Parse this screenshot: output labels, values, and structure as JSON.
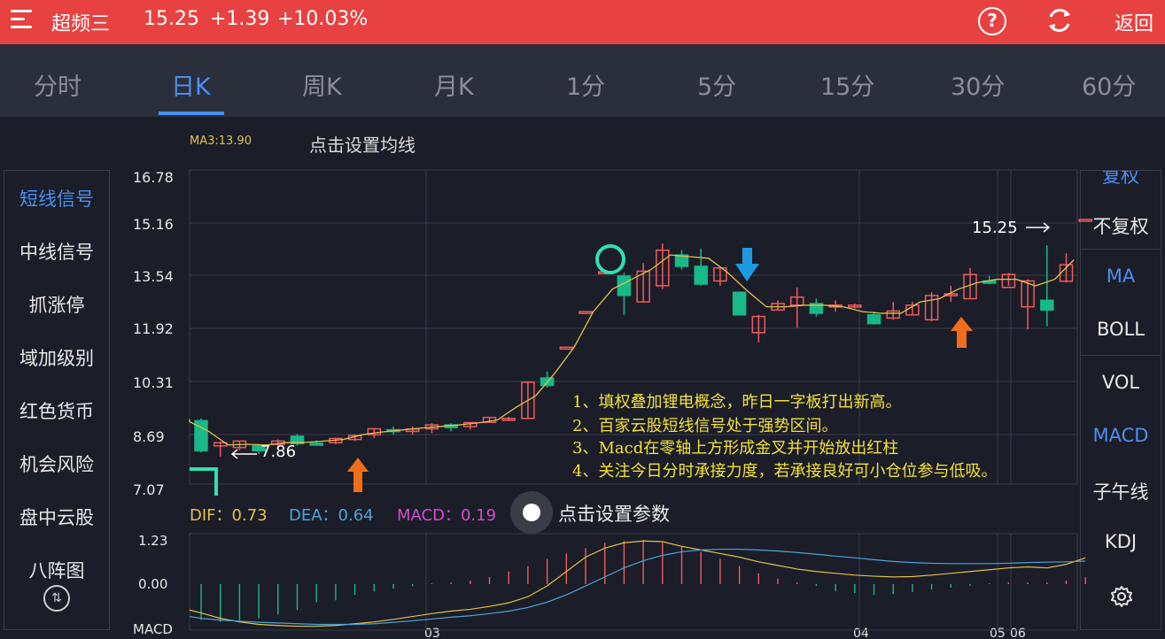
{
  "header": {
    "stock_name": "超频三",
    "price": "15.25",
    "change": "+1.39",
    "change_pct": "+10.03%",
    "back_label": "返回"
  },
  "tabs": [
    "分时",
    "日K",
    "周K",
    "月K",
    "1分",
    "5分",
    "15分",
    "30分",
    "60分"
  ],
  "active_tab": "日K",
  "ma_label": "MA3:13.90",
  "ma_setting": "点击设置均线",
  "left_menu": [
    "短线信号",
    "中线信号",
    "抓涨停",
    "域加级别",
    "红色货币",
    "机会风险",
    "盘中云股",
    "八阵图"
  ],
  "left_active": "短线信号",
  "left_bottom_icon": "toggle-icon",
  "right_menu": [
    "复权",
    "不复权",
    "MA",
    "BOLL",
    "VOL",
    "MACD",
    "子午线",
    "KDJ"
  ],
  "right_active": [
    "复权",
    "MA",
    "MACD"
  ],
  "price_axis": [
    "16.78",
    "15.16",
    "13.54",
    "11.92",
    "10.31",
    "8.69",
    "7.07"
  ],
  "macd_axis": [
    "1.23",
    "0.00",
    "MACD"
  ],
  "x_axis": [
    "03",
    "04",
    "05",
    "06"
  ],
  "low_marker": "7.86",
  "last_marker": "15.25",
  "annotations": [
    "1、填权叠加锂电概念，昨日一字板打出新高。",
    "2、百家云股短线信号处于强势区间。",
    "3、Macd在零轴上方形成金叉并开始放出红柱",
    "4、关注今日分时承接力度，若承接良好可小仓位参与低吸。"
  ],
  "indicators": {
    "dif": "DIF：0.73",
    "dea": "DEA：0.64",
    "macd": "MACD：0.19"
  },
  "indicator_setting": "点击设置参数",
  "colors": {
    "up": "#f05b5b",
    "down": "#19b888",
    "ma": "#e0c14a",
    "dif": "#e0c14a",
    "dea": "#4da3d8",
    "accent": "#4b8ff0",
    "header": "#e84141",
    "arrow_up": "#f26d1a",
    "arrow_down": "#1e9be0"
  },
  "chart_data": {
    "type": "candlestick",
    "ylim": [
      7.07,
      16.78
    ],
    "candles": [
      {
        "o": 9.03,
        "h": 9.1,
        "c": 8.1,
        "l": 8.05
      },
      {
        "o": 8.25,
        "h": 8.38,
        "c": 8.35,
        "l": 7.92
      },
      {
        "o": 8.2,
        "h": 8.38,
        "c": 8.4,
        "l": 8.12
      },
      {
        "o": 8.25,
        "h": 8.3,
        "c": 8.1,
        "l": 8.0
      },
      {
        "o": 8.3,
        "h": 8.45,
        "c": 8.4,
        "l": 8.25
      },
      {
        "o": 8.55,
        "h": 8.62,
        "c": 8.32,
        "l": 8.26
      },
      {
        "o": 8.33,
        "h": 8.42,
        "c": 8.32,
        "l": 8.28
      },
      {
        "o": 8.35,
        "h": 8.5,
        "c": 8.48,
        "l": 8.3
      },
      {
        "o": 8.45,
        "h": 8.6,
        "c": 8.57,
        "l": 8.4
      },
      {
        "o": 8.6,
        "h": 8.8,
        "c": 8.78,
        "l": 8.5
      },
      {
        "o": 8.75,
        "h": 8.85,
        "c": 8.72,
        "l": 8.6
      },
      {
        "o": 8.7,
        "h": 8.85,
        "c": 8.77,
        "l": 8.6
      },
      {
        "o": 8.78,
        "h": 8.95,
        "c": 8.9,
        "l": 8.65
      },
      {
        "o": 8.9,
        "h": 8.95,
        "c": 8.82,
        "l": 8.7
      },
      {
        "o": 8.85,
        "h": 8.97,
        "c": 8.97,
        "l": 8.75
      },
      {
        "o": 8.98,
        "h": 9.13,
        "c": 9.13,
        "l": 8.98
      },
      {
        "o": 9.05,
        "h": 9.15,
        "c": 9.1,
        "l": 9.02
      },
      {
        "o": 9.1,
        "h": 10.25,
        "c": 10.22,
        "l": 9.1
      },
      {
        "o": 10.35,
        "h": 10.55,
        "c": 10.12,
        "l": 10.05
      },
      {
        "o": 11.3,
        "h": 11.3,
        "c": 11.3,
        "l": 11.3
      },
      {
        "o": 12.4,
        "h": 12.4,
        "c": 12.4,
        "l": 12.4
      },
      {
        "o": 13.63,
        "h": 13.63,
        "c": 13.63,
        "l": 13.63
      },
      {
        "o": 13.5,
        "h": 13.6,
        "c": 12.9,
        "l": 12.3
      },
      {
        "o": 12.7,
        "h": 13.9,
        "c": 13.65,
        "l": 12.7
      },
      {
        "o": 13.2,
        "h": 14.5,
        "c": 14.3,
        "l": 13.1
      },
      {
        "o": 14.15,
        "h": 14.3,
        "c": 13.8,
        "l": 13.7
      },
      {
        "o": 13.8,
        "h": 14.35,
        "c": 13.25,
        "l": 13.2
      },
      {
        "o": 13.35,
        "h": 13.8,
        "c": 13.75,
        "l": 13.2
      },
      {
        "o": 13.0,
        "h": 13.0,
        "c": 12.3,
        "l": 12.3
      },
      {
        "o": 11.75,
        "h": 12.3,
        "c": 12.25,
        "l": 11.45
      },
      {
        "o": 12.45,
        "h": 12.75,
        "c": 12.65,
        "l": 12.45
      },
      {
        "o": 12.6,
        "h": 13.15,
        "c": 12.85,
        "l": 11.9
      },
      {
        "o": 12.65,
        "h": 12.8,
        "c": 12.35,
        "l": 12.25
      },
      {
        "o": 12.6,
        "h": 12.75,
        "c": 12.6,
        "l": 12.4
      },
      {
        "o": 12.55,
        "h": 12.65,
        "c": 12.6,
        "l": 12.5
      },
      {
        "o": 12.3,
        "h": 12.4,
        "c": 12.03,
        "l": 12.0
      },
      {
        "o": 12.2,
        "h": 12.7,
        "c": 12.42,
        "l": 12.15
      },
      {
        "o": 12.3,
        "h": 12.7,
        "c": 12.6,
        "l": 12.3
      },
      {
        "o": 12.15,
        "h": 13.0,
        "c": 12.9,
        "l": 12.1
      },
      {
        "o": 12.95,
        "h": 13.2,
        "c": 12.95,
        "l": 12.7
      },
      {
        "o": 12.8,
        "h": 13.75,
        "c": 13.55,
        "l": 12.8
      },
      {
        "o": 13.35,
        "h": 13.5,
        "c": 13.28,
        "l": 13.25
      },
      {
        "o": 13.15,
        "h": 13.6,
        "c": 13.55,
        "l": 13.2
      },
      {
        "o": 12.55,
        "h": 13.4,
        "c": 13.35,
        "l": 11.85
      },
      {
        "o": 12.75,
        "h": 14.45,
        "c": 12.45,
        "l": 11.95
      },
      {
        "o": 13.34,
        "h": 14.2,
        "c": 13.85,
        "l": 13.3
      },
      {
        "o": 15.25,
        "h": 15.25,
        "c": 15.25,
        "l": 15.25
      }
    ],
    "ma3": [
      9.0,
      8.7,
      8.28,
      8.3,
      8.28,
      8.35,
      8.36,
      8.4,
      8.45,
      8.6,
      8.68,
      8.74,
      8.8,
      8.85,
      8.9,
      8.96,
      9.05,
      9.45,
      9.8,
      10.5,
      11.3,
      12.4,
      13.1,
      13.4,
      13.7,
      14.15,
      14.1,
      14.05,
      13.6,
      13.05,
      12.55,
      12.55,
      12.6,
      12.6,
      12.55,
      12.4,
      12.35,
      12.35,
      12.7,
      12.8,
      13.1,
      13.3,
      13.4,
      13.4,
      13.2,
      13.4,
      14.0
    ],
    "macd_hist": [
      -1.0,
      -1.05,
      -1.0,
      -0.95,
      -0.85,
      -0.72,
      -0.5,
      -0.45,
      -0.3,
      -0.2,
      -0.12,
      -0.06,
      0.02,
      0.05,
      0.1,
      0.2,
      0.35,
      0.5,
      0.7,
      0.85,
      1.0,
      1.15,
      1.2,
      1.23,
      1.15,
      1.05,
      0.9,
      0.7,
      0.5,
      0.3,
      0.15,
      0.05,
      -0.05,
      -0.2,
      -0.25,
      -0.3,
      -0.28,
      -0.22,
      -0.15,
      -0.1,
      -0.05,
      0.02,
      0.05,
      0.05,
      0.05,
      0.1,
      0.19
    ],
    "dif": [
      -0.8,
      -0.95,
      -1.05,
      -1.12,
      -1.15,
      -1.17,
      -1.17,
      -1.15,
      -1.1,
      -1.05,
      -0.98,
      -0.9,
      -0.82,
      -0.75,
      -0.7,
      -0.62,
      -0.52,
      -0.35,
      -0.05,
      0.35,
      0.75,
      1.0,
      1.15,
      1.2,
      1.18,
      1.05,
      0.95,
      0.85,
      0.75,
      0.62,
      0.52,
      0.42,
      0.35,
      0.3,
      0.25,
      0.22,
      0.2,
      0.21,
      0.25,
      0.3,
      0.35,
      0.4,
      0.45,
      0.48,
      0.45,
      0.55,
      0.73
    ],
    "dea": [
      -0.95,
      -1.0,
      -1.03,
      -1.06,
      -1.08,
      -1.1,
      -1.12,
      -1.12,
      -1.12,
      -1.1,
      -1.06,
      -1.02,
      -0.97,
      -0.92,
      -0.88,
      -0.82,
      -0.75,
      -0.65,
      -0.5,
      -0.3,
      -0.05,
      0.2,
      0.45,
      0.65,
      0.8,
      0.9,
      0.95,
      0.97,
      0.97,
      0.95,
      0.92,
      0.88,
      0.83,
      0.78,
      0.73,
      0.68,
      0.63,
      0.6,
      0.58,
      0.57,
      0.57,
      0.57,
      0.58,
      0.6,
      0.61,
      0.62,
      0.64
    ]
  }
}
